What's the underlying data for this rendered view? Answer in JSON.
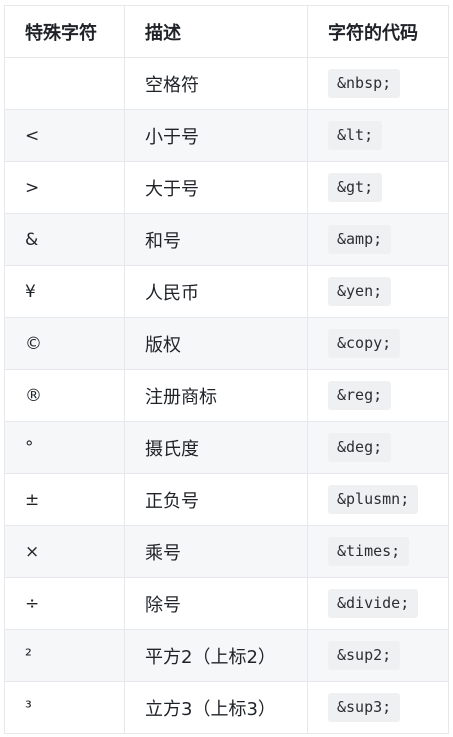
{
  "table": {
    "headers": [
      "特殊字符",
      "描述",
      "字符的代码"
    ],
    "rows": [
      {
        "char": "",
        "desc": "空格符",
        "code": "&nbsp;"
      },
      {
        "char": "<",
        "desc": "小于号",
        "code": "&lt;"
      },
      {
        "char": ">",
        "desc": "大于号",
        "code": "&gt;"
      },
      {
        "char": "&",
        "desc": "和号",
        "code": "&amp;"
      },
      {
        "char": "¥",
        "desc": "人民币",
        "code": "&yen;"
      },
      {
        "char": "©",
        "desc": "版权",
        "code": "&copy;"
      },
      {
        "char": "®",
        "desc": "注册商标",
        "code": "&reg;"
      },
      {
        "char": "°",
        "desc": "摄氏度",
        "code": "&deg;"
      },
      {
        "char": "±",
        "desc": "正负号",
        "code": "&plusmn;"
      },
      {
        "char": "×",
        "desc": "乘号",
        "code": "&times;"
      },
      {
        "char": "÷",
        "desc": "除号",
        "code": "&divide;"
      },
      {
        "char": "²",
        "desc": "平方2（上标2）",
        "code": "&sup2;"
      },
      {
        "char": "³",
        "desc": "立方3（上标3）",
        "code": "&sup3;"
      }
    ]
  }
}
